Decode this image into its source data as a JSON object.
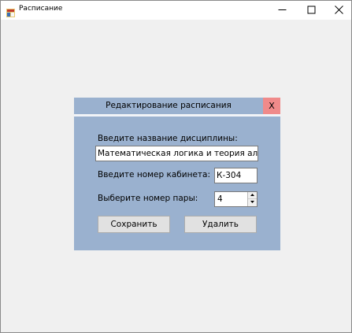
{
  "window": {
    "title": "Расписание"
  },
  "dialog": {
    "title": "Редактирование расписания",
    "close_label": "X",
    "discipline_label": "Введите название дисциплины:",
    "discipline_value": "Математическая логика и теория алгоритмов",
    "room_label": "Введите номер кабинета:",
    "room_value": "К-304",
    "pair_label": "Выберите номер пары:",
    "pair_value": "4",
    "save_label": "Сохранить",
    "delete_label": "Удалить"
  },
  "colors": {
    "dialog_bg": "#9ab1cf",
    "close_bg": "#f08a8a",
    "window_bg": "#f0f0f0"
  }
}
